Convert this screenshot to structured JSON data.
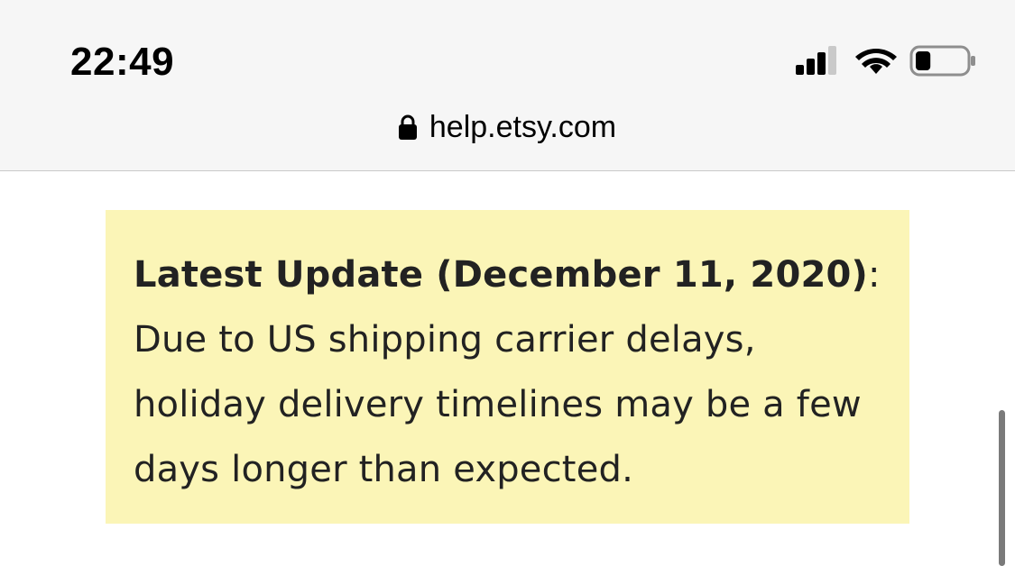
{
  "status_bar": {
    "time": "22:49",
    "icons": [
      "cellular-signal-icon",
      "wifi-icon",
      "battery-icon"
    ],
    "signal_bars_filled": 3,
    "signal_bars_total": 4,
    "battery_level": 0.3
  },
  "browser": {
    "url": "help.etsy.com",
    "secure_icon": "lock-icon"
  },
  "notice": {
    "heading": "Latest Update (December 11, 2020)",
    "heading_suffix": ":",
    "body": "Due to US shipping carrier delays, holiday delivery timelines may be a few days longer than expected.",
    "background_color": "#fbf5b7"
  },
  "colors": {
    "toolbar_background": "#f6f6f6",
    "page_background": "#ffffff",
    "text": "#222222"
  }
}
